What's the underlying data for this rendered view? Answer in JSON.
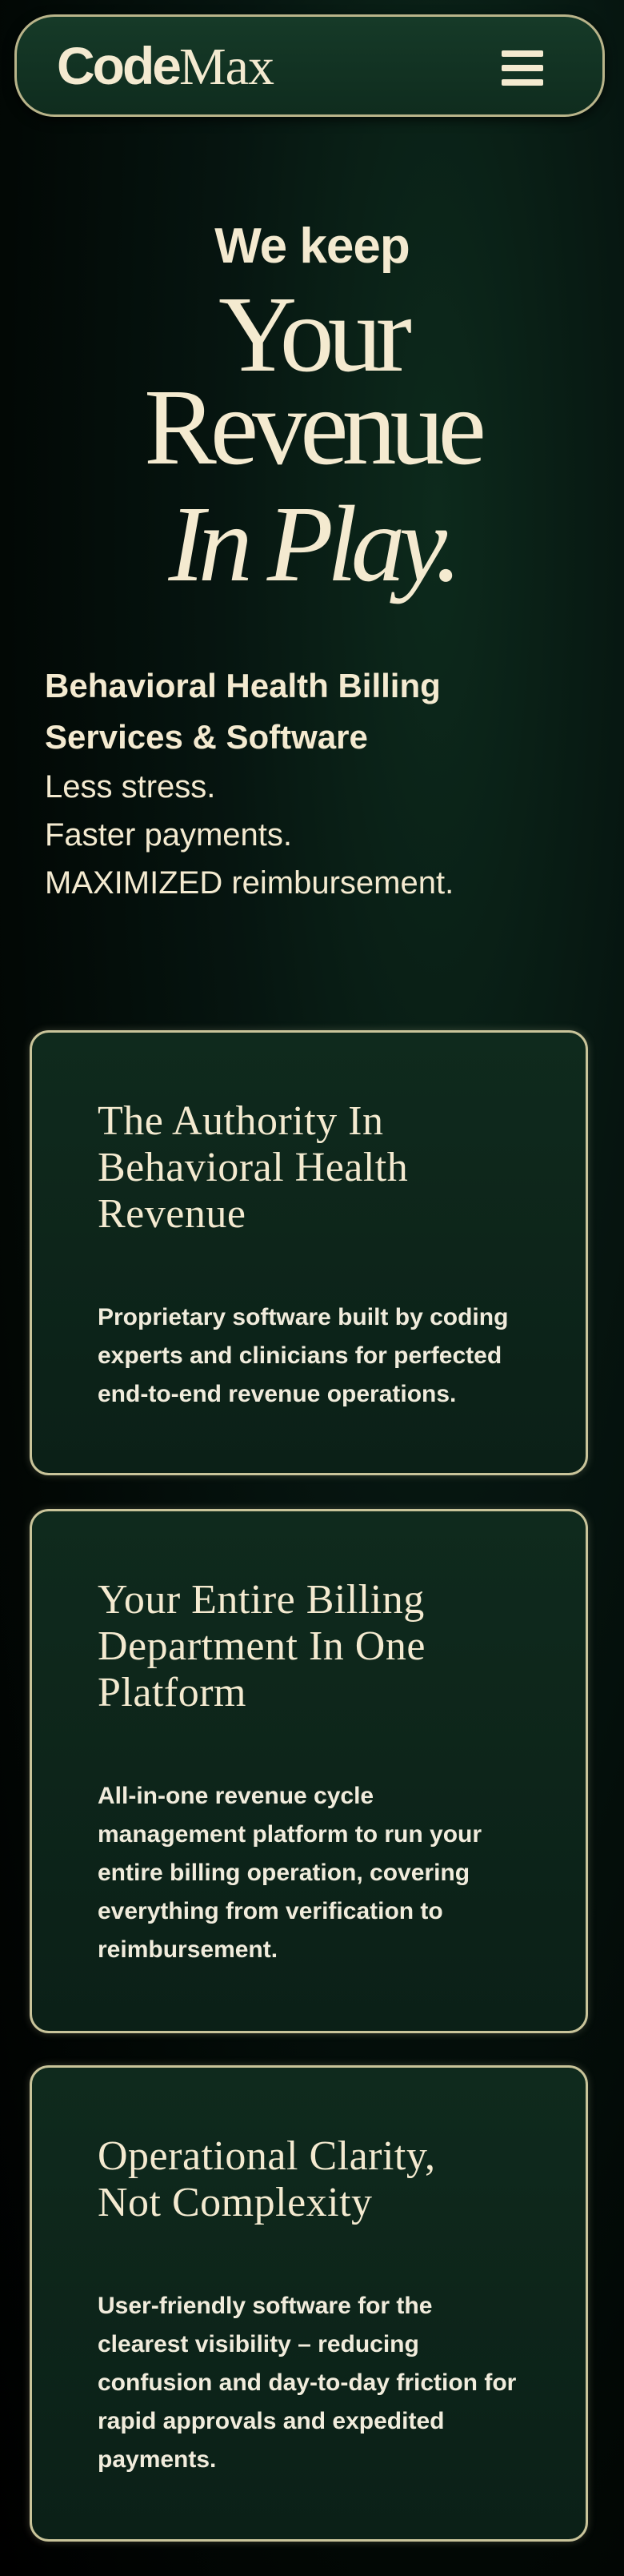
{
  "nav": {
    "logo_code": "Code",
    "logo_max": "Max",
    "menu_icon": "hamburger-menu-icon"
  },
  "hero": {
    "kicker": "We keep",
    "line1": "Your",
    "line2": "Revenue",
    "line3": "In Play."
  },
  "subhead": {
    "bold_line1": "Behavioral Health Billing",
    "bold_line2": "Services & Software",
    "line1": "Less stress.",
    "line2": "Faster payments.",
    "line3": "MAXIMIZED reimbursement."
  },
  "cards": [
    {
      "title_lines": [
        "The Authority In",
        "Behavioral Health",
        "Revenue"
      ],
      "body_lines": [
        "Proprietary software built by coding",
        "experts and clinicians for perfected",
        "end-to-end revenue operations."
      ]
    },
    {
      "title_lines": [
        "Your Entire Billing",
        "Department In One",
        "Platform"
      ],
      "body_lines": [
        "All-in-one revenue cycle",
        "management platform to run your",
        "entire billing operation, covering",
        "everything from verification to",
        "reimbursement."
      ]
    },
    {
      "title_lines": [
        "Operational Clarity,",
        "Not Complexity"
      ],
      "body_lines": [
        "User-friendly software for the",
        "clearest visibility – reducing",
        "confusion and day-to-day friction for",
        "rapid approvals and expedited",
        "payments."
      ]
    }
  ],
  "colors": {
    "cream": "#f4ead0",
    "card_border": "#c9c49a",
    "nav_bg": "#163a28"
  }
}
